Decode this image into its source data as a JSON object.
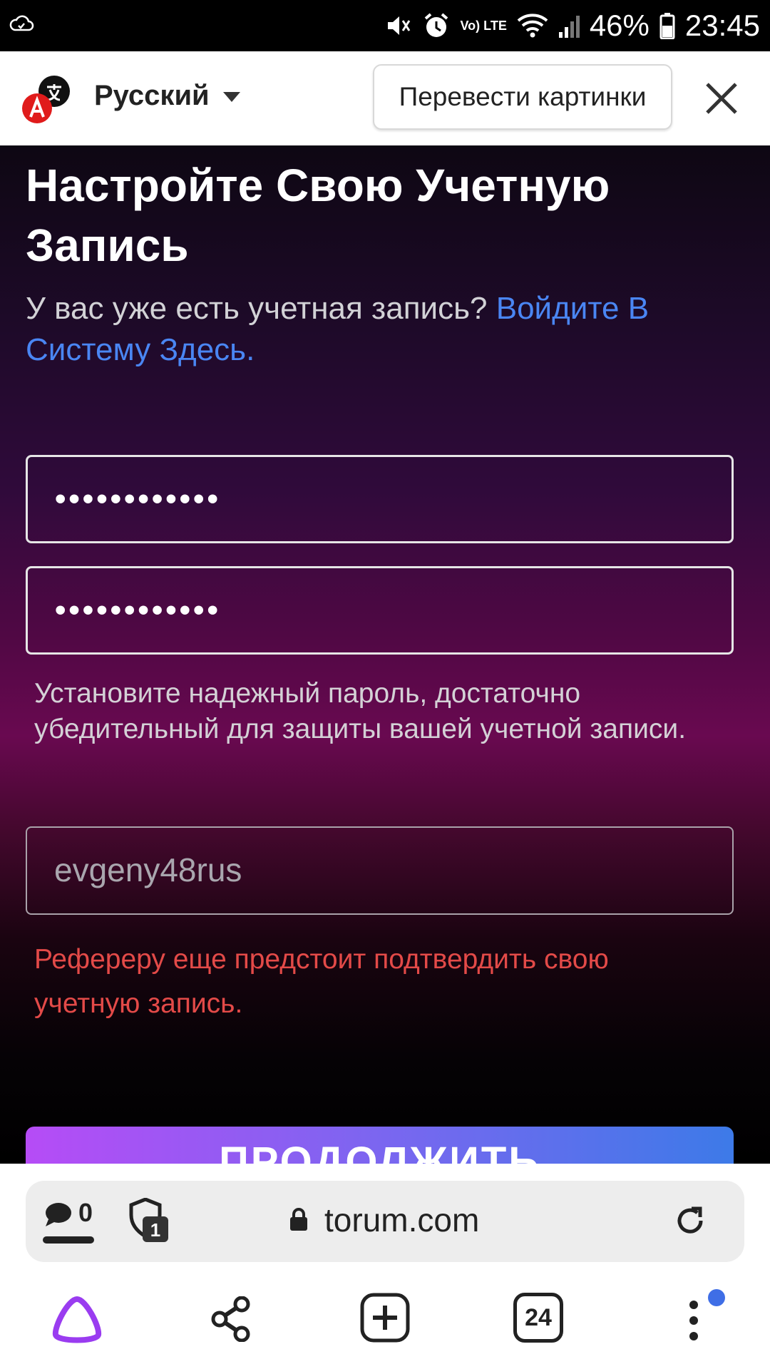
{
  "status_bar": {
    "battery": "46%",
    "time": "23:45",
    "network": "Vo) LTE"
  },
  "translate_bar": {
    "language": "Русский",
    "translate_images_label": "Перевести картинки"
  },
  "page": {
    "title": "Настройте Свою Учетную Запись",
    "subtitle_text": "У вас уже есть учетная запись? ",
    "login_link": "Войдите В Систему Здесь.",
    "password_value": "••••••••••••",
    "confirm_password_value": "••••••••••••",
    "password_hint": "Установите надежный пароль, достаточно убедительный для защиты вашей учетной записи.",
    "referrer_value": "evgeny48rus",
    "referrer_error": " Рефереру еще предстоит подтвердить свою учетную запись.",
    "continue_label": "ПРОДОЛЖИТЬ"
  },
  "browser": {
    "comments_count": "0",
    "shield_count": "1",
    "domain": "torum.com",
    "tabs_count": "24"
  }
}
